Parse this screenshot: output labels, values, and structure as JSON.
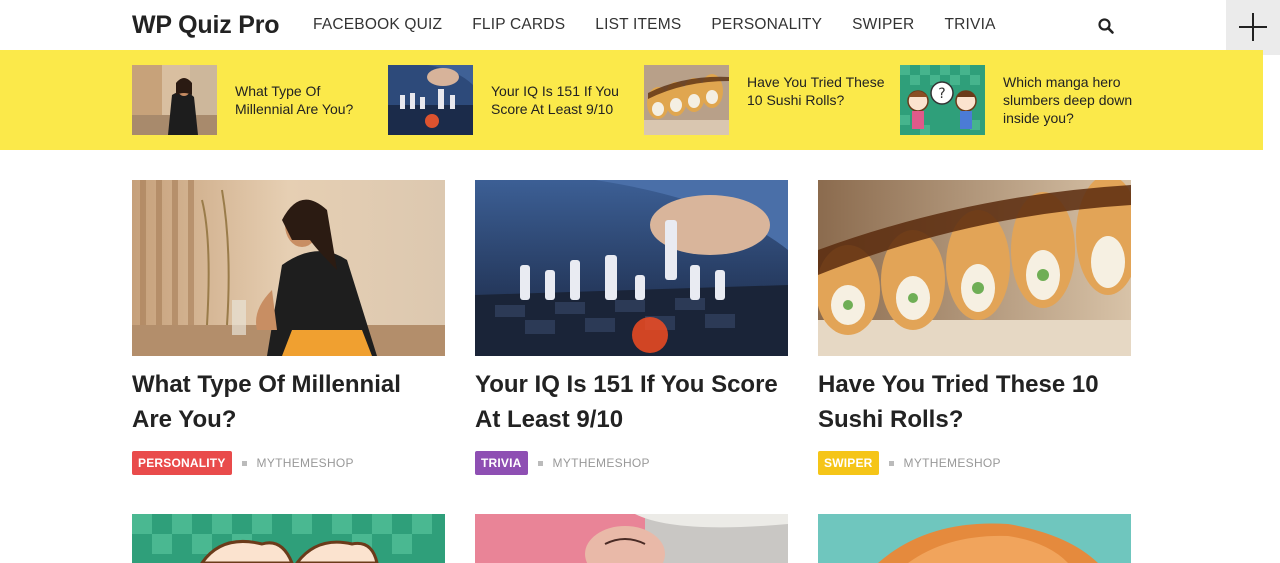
{
  "header": {
    "logo": "WP Quiz Pro",
    "nav": [
      "FACEBOOK QUIZ",
      "FLIP CARDS",
      "LIST ITEMS",
      "PERSONALITY",
      "SWIPER",
      "TRIVIA"
    ],
    "search_icon": "search-icon",
    "plus_icon": "plus-icon"
  },
  "featured": [
    {
      "title": "What Type Of Millennial Are You?"
    },
    {
      "title": "Your IQ Is 151 If You Score At Least 9/10"
    },
    {
      "title": "Have You Tried These 10 Sushi Rolls?"
    },
    {
      "title": "Which manga hero slumbers deep down inside you?"
    }
  ],
  "posts": [
    {
      "title": "What Type Of Millennial Are You?",
      "category": "PERSONALITY",
      "category_color": "#e94b4b",
      "author": "MYTHEMESHOP"
    },
    {
      "title": "Your IQ Is 151 If You Score At Least 9/10",
      "category": "TRIVIA",
      "category_color": "#8e4fb3",
      "author": "MYTHEMESHOP"
    },
    {
      "title": "Have You Tried These 10 Sushi Rolls?",
      "category": "SWIPER",
      "category_color": "#f5c518",
      "author": "MYTHEMESHOP"
    }
  ],
  "colors": {
    "strip": "#fbe94a",
    "plus_box": "#ebebeb"
  }
}
